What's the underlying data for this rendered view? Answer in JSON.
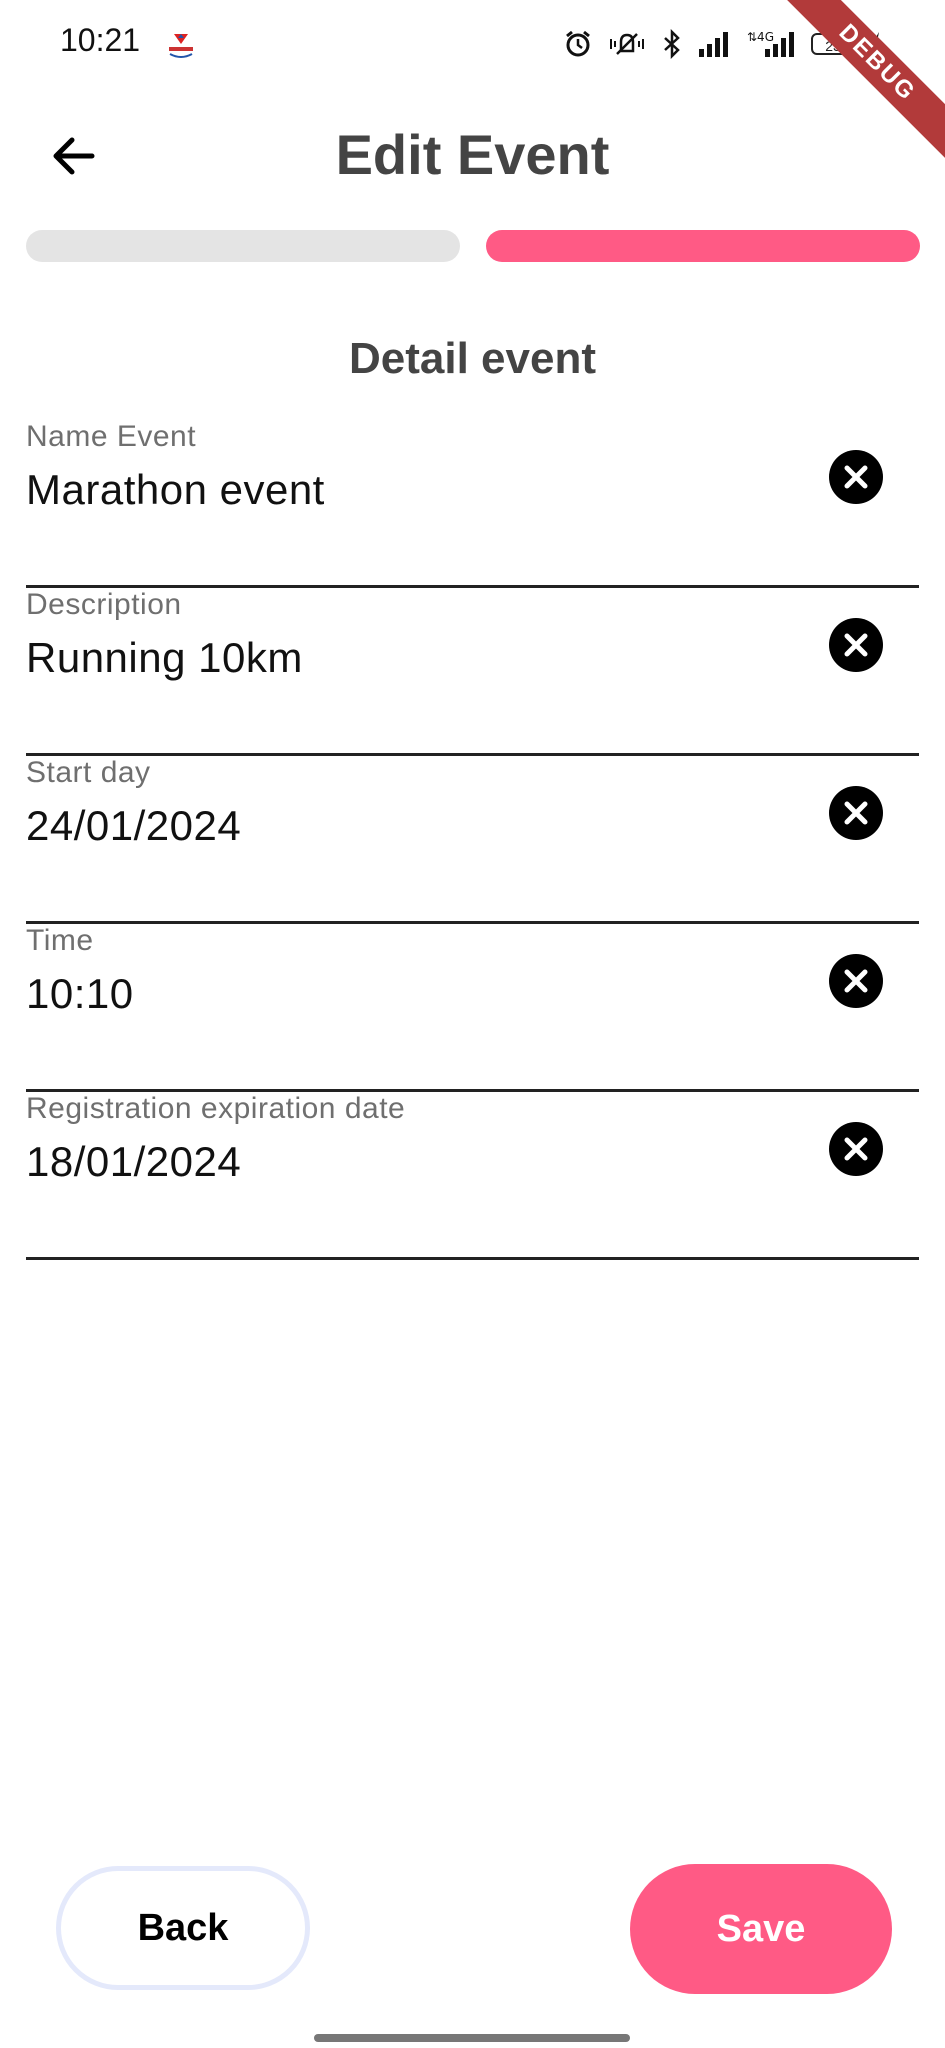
{
  "status_bar": {
    "time": "10:21",
    "battery": "23",
    "debug_banner": "DEBUG",
    "icons": [
      "app-logo-icon",
      "alarm-icon",
      "vibrate-icon",
      "bluetooth-icon",
      "signal-icon",
      "4g-signal-icon",
      "battery-icon",
      "charging-icon"
    ]
  },
  "header": {
    "title": "Edit Event",
    "back_icon": "arrow-left-icon"
  },
  "progress": {
    "steps_total": 2,
    "current_step": 2,
    "inactive_color": "#e4e4e4",
    "active_color": "#ff5a85"
  },
  "form": {
    "section_title": "Detail event",
    "fields": [
      {
        "label": "Name Event",
        "value": "Marathon event"
      },
      {
        "label": "Description",
        "value": "Running 10km"
      },
      {
        "label": "Start day",
        "value": "24/01/2024"
      },
      {
        "label": "Time",
        "value": "10:10"
      },
      {
        "label": "Registration expiration date",
        "value": "18/01/2024"
      }
    ],
    "clear_icon": "clear-circle-icon"
  },
  "actions": {
    "back_label": "Back",
    "save_label": "Save",
    "save_color": "#ff5a85"
  }
}
